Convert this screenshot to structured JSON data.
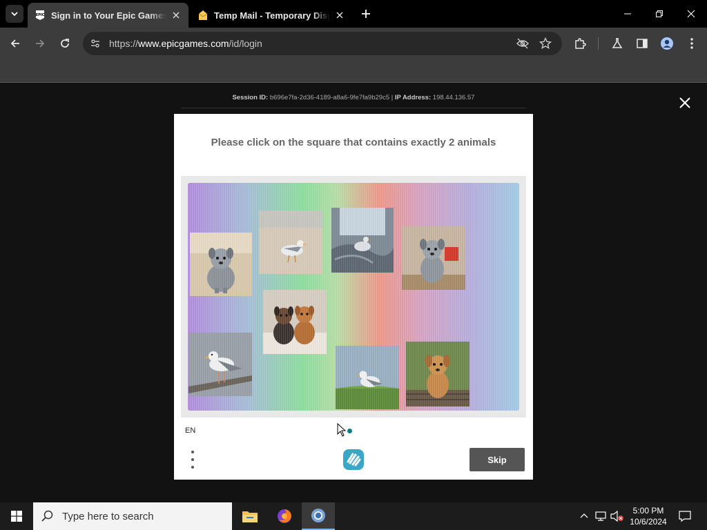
{
  "browser": {
    "tabs": [
      {
        "title": "Sign in to Your Epic Games acc",
        "favicon": "epic-games-icon",
        "active": true
      },
      {
        "title": "Temp Mail - Temporary Dispos",
        "favicon": "temp-mail-icon",
        "active": false
      }
    ],
    "url_prefix": "https://",
    "url_domain": "www.epicgames.com",
    "url_path": "/id/login"
  },
  "page": {
    "session_label": "Session ID:",
    "session_id": "b696e7fa-2d36-4189-a8a6-9fe7fa9b29c5",
    "ip_label": "IP Address:",
    "ip_address": "198.44.136.57"
  },
  "captcha": {
    "prompt": "Please click on the square that contains exactly 2 animals",
    "language": "EN",
    "skip_label": "Skip",
    "tiles": [
      {
        "id": "tile-puppy-grey-beach",
        "content": "grey puppy on sand"
      },
      {
        "id": "tile-seagull-beach",
        "content": "seagull on beach"
      },
      {
        "id": "tile-seagull-bed",
        "content": "seagull on bed"
      },
      {
        "id": "tile-puppy-grey-room",
        "content": "grey puppy in room"
      },
      {
        "id": "tile-two-puppies",
        "content": "two puppies on blanket"
      },
      {
        "id": "tile-seagull-railing",
        "content": "seagull on railing"
      },
      {
        "id": "tile-seagull-grass",
        "content": "seagull on grass"
      },
      {
        "id": "tile-puppy-golden-bench",
        "content": "golden puppy on bench"
      }
    ]
  },
  "taskbar": {
    "search_placeholder": "Type here to search",
    "time": "5:00 PM",
    "date": "10/6/2024"
  }
}
